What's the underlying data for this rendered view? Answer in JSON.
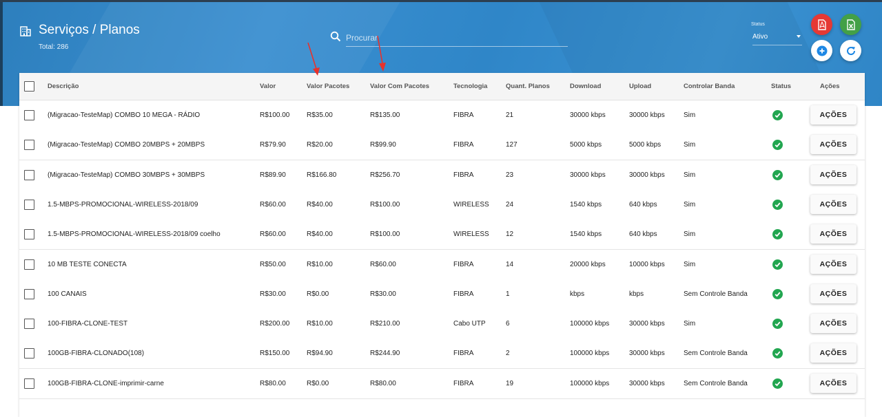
{
  "header": {
    "title": "Serviços / Planos",
    "total_label": "Total: 286",
    "search_placeholder": "Procurar",
    "status_filter": {
      "label": "Status",
      "value": "Ativo"
    },
    "icons": [
      "building-icon",
      "search-icon",
      "pdf-icon",
      "excel-icon",
      "plus-icon",
      "refresh-icon"
    ],
    "colors": {
      "header_bg": "#2f86c8",
      "pdf": "#e53935",
      "excel": "#43a047",
      "status_ok": "#22a650"
    }
  },
  "table": {
    "columns": [
      "Descrição",
      "Valor",
      "Valor Pacotes",
      "Valor Com Pacotes",
      "Tecnologia",
      "Quant. Planos",
      "Download",
      "Upload",
      "Controlar Banda",
      "Status",
      "Ações"
    ],
    "action_label": "AÇÕES",
    "rows": [
      {
        "descricao": "(Migracao-TesteMap) COMBO 10 MEGA - RÁDIO",
        "valor": "R$100.00",
        "valor_pacotes": "R$35.00",
        "valor_com_pacotes": "R$135.00",
        "tecnologia": "FIBRA",
        "quant_planos": "21",
        "download": "30000 kbps",
        "upload": "30000 kbps",
        "controlar_banda": "Sim"
      },
      {
        "descricao": "(Migracao-TesteMap) COMBO 20MBPS + 20MBPS",
        "valor": "R$79.90",
        "valor_pacotes": "R$20.00",
        "valor_com_pacotes": "R$99.90",
        "tecnologia": "FIBRA",
        "quant_planos": "127",
        "download": "5000 kbps",
        "upload": "5000 kbps",
        "controlar_banda": "Sim"
      },
      {
        "descricao": "(Migracao-TesteMap) COMBO 30MBPS + 30MBPS",
        "valor": "R$89.90",
        "valor_pacotes": "R$166.80",
        "valor_com_pacotes": "R$256.70",
        "tecnologia": "FIBRA",
        "quant_planos": "23",
        "download": "30000 kbps",
        "upload": "30000 kbps",
        "controlar_banda": "Sim"
      },
      {
        "descricao": "1.5-MBPS-PROMOCIONAL-WIRELESS-2018/09",
        "valor": "R$60.00",
        "valor_pacotes": "R$40.00",
        "valor_com_pacotes": "R$100.00",
        "tecnologia": "WIRELESS",
        "quant_planos": "24",
        "download": "1540 kbps",
        "upload": "640 kbps",
        "controlar_banda": "Sim"
      },
      {
        "descricao": "1.5-MBPS-PROMOCIONAL-WIRELESS-2018/09 coelho",
        "valor": "R$60.00",
        "valor_pacotes": "R$40.00",
        "valor_com_pacotes": "R$100.00",
        "tecnologia": "WIRELESS",
        "quant_planos": "12",
        "download": "1540 kbps",
        "upload": "640 kbps",
        "controlar_banda": "Sim"
      },
      {
        "descricao": "10 MB TESTE CONECTA",
        "valor": "R$50.00",
        "valor_pacotes": "R$10.00",
        "valor_com_pacotes": "R$60.00",
        "tecnologia": "FIBRA",
        "quant_planos": "14",
        "download": "20000 kbps",
        "upload": "10000 kbps",
        "controlar_banda": "Sim"
      },
      {
        "descricao": "100 CANAIS",
        "valor": "R$30.00",
        "valor_pacotes": "R$0.00",
        "valor_com_pacotes": "R$30.00",
        "tecnologia": "FIBRA",
        "quant_planos": "1",
        "download": "kbps",
        "upload": "kbps",
        "controlar_banda": "Sem Controle Banda"
      },
      {
        "descricao": "100-FIBRA-CLONE-TEST",
        "valor": "R$200.00",
        "valor_pacotes": "R$10.00",
        "valor_com_pacotes": "R$210.00",
        "tecnologia": "Cabo UTP",
        "quant_planos": "6",
        "download": "100000 kbps",
        "upload": "30000 kbps",
        "controlar_banda": "Sim"
      },
      {
        "descricao": "100GB-FIBRA-CLONADO(108)",
        "valor": "R$150.00",
        "valor_pacotes": "R$94.90",
        "valor_com_pacotes": "R$244.90",
        "tecnologia": "FIBRA",
        "quant_planos": "2",
        "download": "100000 kbps",
        "upload": "30000 kbps",
        "controlar_banda": "Sem Controle Banda"
      },
      {
        "descricao": "100GB-FIBRA-CLONE-imprimir-carne",
        "valor": "R$80.00",
        "valor_pacotes": "R$0.00",
        "valor_com_pacotes": "R$80.00",
        "tecnologia": "FIBRA",
        "quant_planos": "19",
        "download": "100000 kbps",
        "upload": "30000 kbps",
        "controlar_banda": "Sem Controle Banda"
      }
    ]
  }
}
